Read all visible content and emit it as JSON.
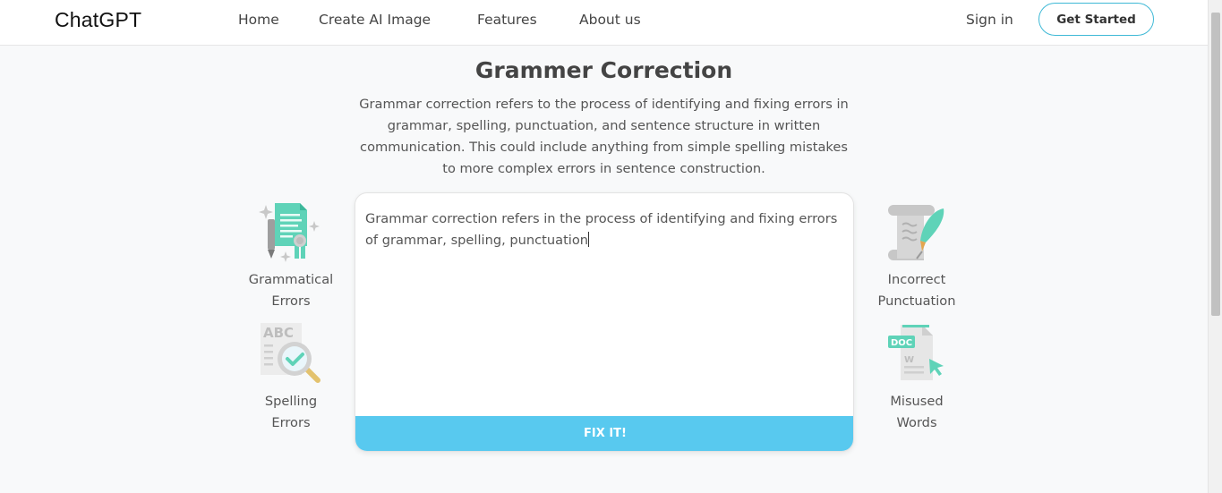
{
  "brand": "ChatGPT",
  "nav": {
    "home": "Home",
    "create_image": "Create AI Image",
    "features": "Features",
    "about": "About us",
    "sign_in": "Sign in",
    "get_started": "Get Started"
  },
  "page": {
    "title": "Grammer Correction",
    "description": "Grammar correction refers to the process of identifying and fixing errors in grammar, spelling, punctuation, and sentence structure in written communication. This could include anything from simple spelling mistakes to more complex errors in sentence construction."
  },
  "features": {
    "grammatical": {
      "line1": "Grammatical",
      "line2": "Errors",
      "icon": "document-pencil-icon"
    },
    "spelling": {
      "line1": "Spelling",
      "line2": "Errors",
      "icon": "abc-magnifier-icon"
    },
    "punctuation": {
      "line1": "Incorrect",
      "line2": "Punctuation",
      "icon": "scroll-quill-icon"
    },
    "misused": {
      "line1": "Misused",
      "line2": "Words",
      "icon": "doc-file-cursor-icon"
    }
  },
  "editor": {
    "text": "Grammar correction refers in the process of identifying and fixing errors of grammar, spelling, punctuation",
    "button": "FIX IT!"
  },
  "colors": {
    "accent": "#58c9ef",
    "outline": "#3fb9d6",
    "icon_teal": "#5fd3b8"
  }
}
